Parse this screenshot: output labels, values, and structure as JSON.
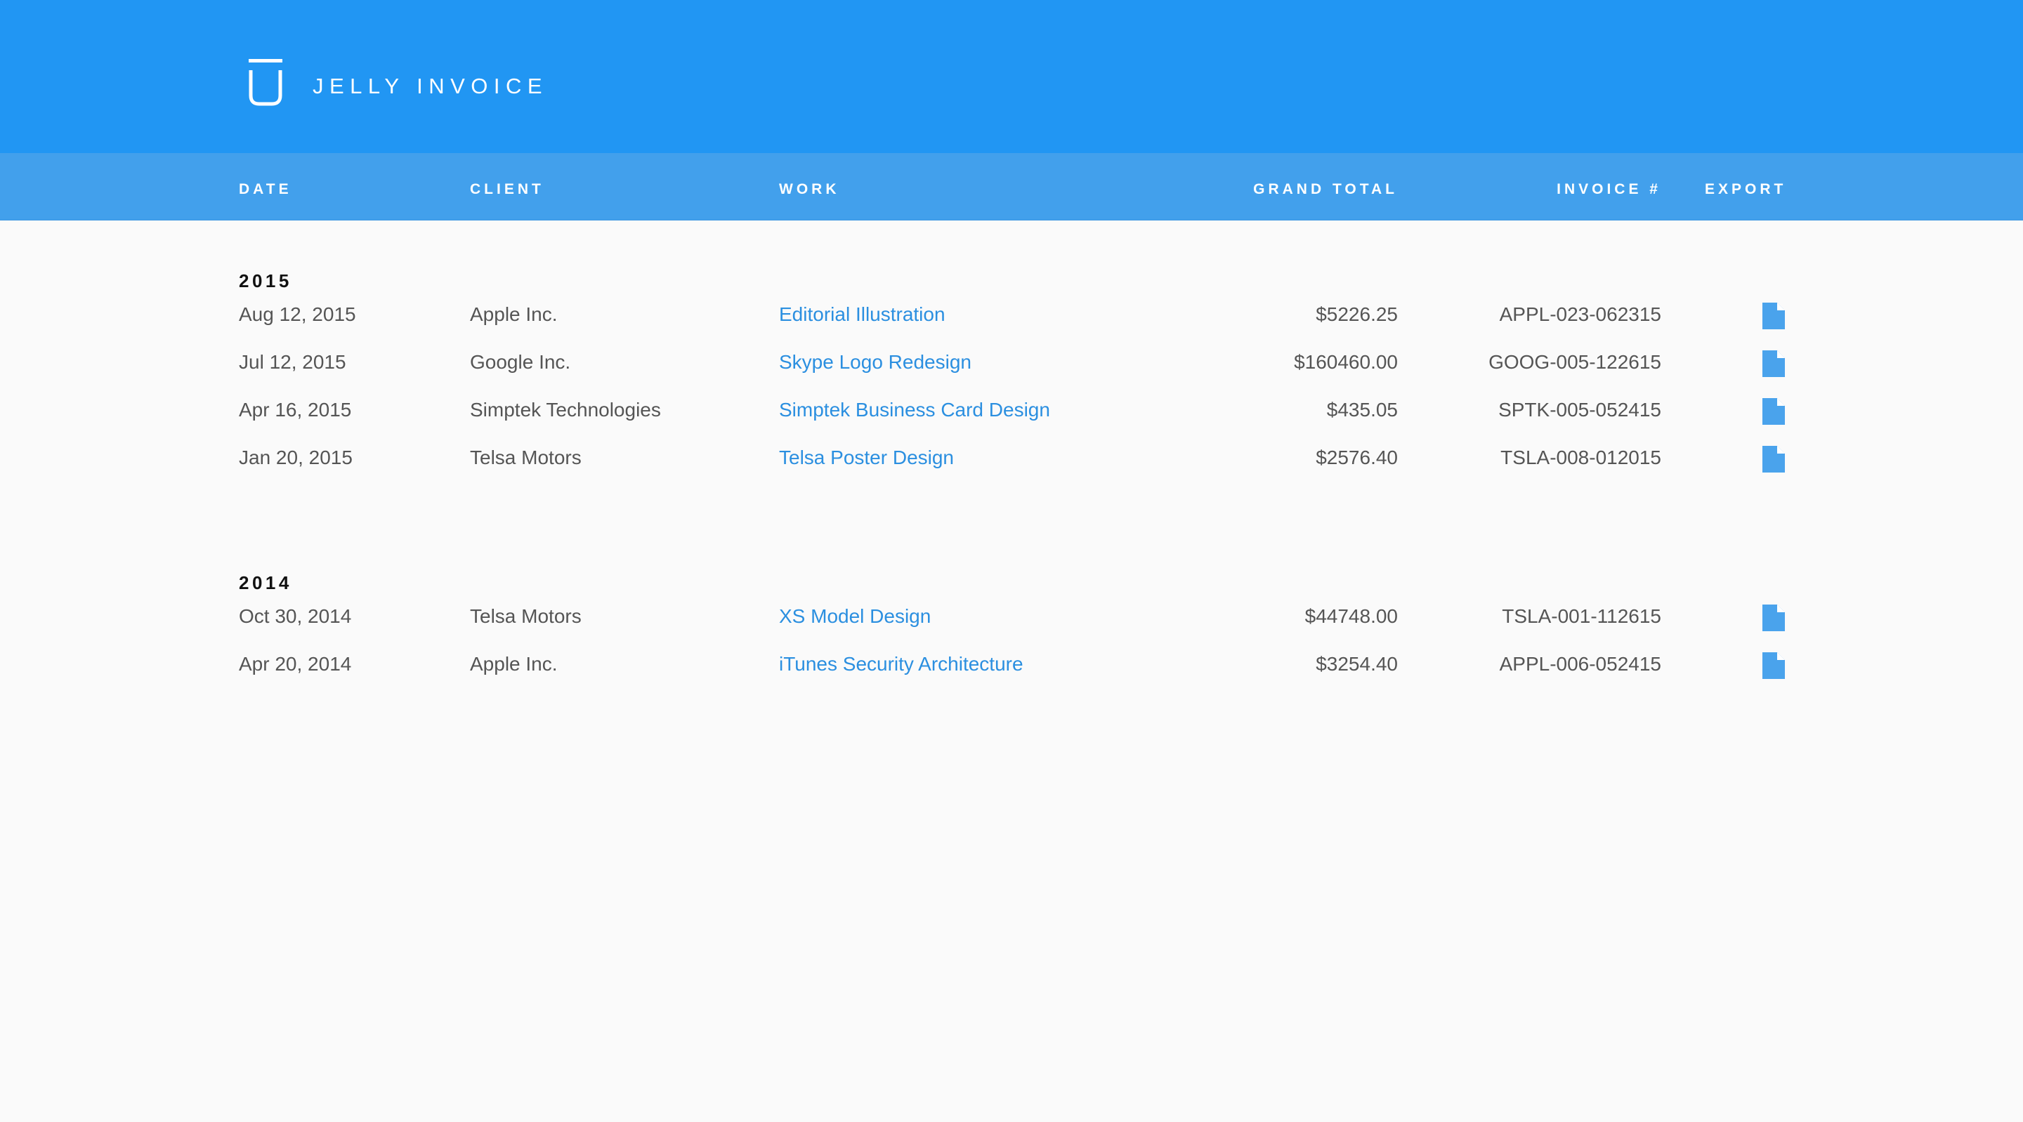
{
  "header": {
    "brand": "JELLY INVOICE",
    "logo_icon": "jelly-glass-icon",
    "background_color": "#2196f3"
  },
  "columns": {
    "date": "DATE",
    "client": "CLIENT",
    "work": "WORK",
    "grand_total": "GRAND TOTAL",
    "invoice": "INVOICE #",
    "export": "EXPORT",
    "background_color": "#42a0ec"
  },
  "groups": [
    {
      "year": "2015",
      "rows": [
        {
          "date": "Aug 12, 2015",
          "client": "Apple Inc.",
          "work": "Editorial Illustration",
          "total": "$5226.25",
          "invoice": "APPL-023-062315",
          "export_icon": "document-icon"
        },
        {
          "date": "Jul 12, 2015",
          "client": "Google Inc.",
          "work": "Skype Logo Redesign",
          "total": "$160460.00",
          "invoice": "GOOG-005-122615",
          "export_icon": "document-icon"
        },
        {
          "date": "Apr 16, 2015",
          "client": "Simptek Technologies",
          "work": "Simptek Business Card Design",
          "total": "$435.05",
          "invoice": "SPTK-005-052415",
          "export_icon": "document-icon"
        },
        {
          "date": "Jan 20, 2015",
          "client": "Telsa Motors",
          "work": "Telsa Poster Design",
          "total": "$2576.40",
          "invoice": "TSLA-008-012015",
          "export_icon": "document-icon"
        }
      ]
    },
    {
      "year": "2014",
      "rows": [
        {
          "date": "Oct 30, 2014",
          "client": "Telsa Motors",
          "work": "XS Model Design",
          "total": "$44748.00",
          "invoice": "TSLA-001-112615",
          "export_icon": "document-icon"
        },
        {
          "date": "Apr 20, 2014",
          "client": "Apple Inc.",
          "work": "iTunes Security Architecture",
          "total": "$3254.40",
          "invoice": "APPL-006-052415",
          "export_icon": "document-icon"
        }
      ]
    }
  ],
  "link_color": "#2b8fe0",
  "icon_color": "#4aa3ec"
}
